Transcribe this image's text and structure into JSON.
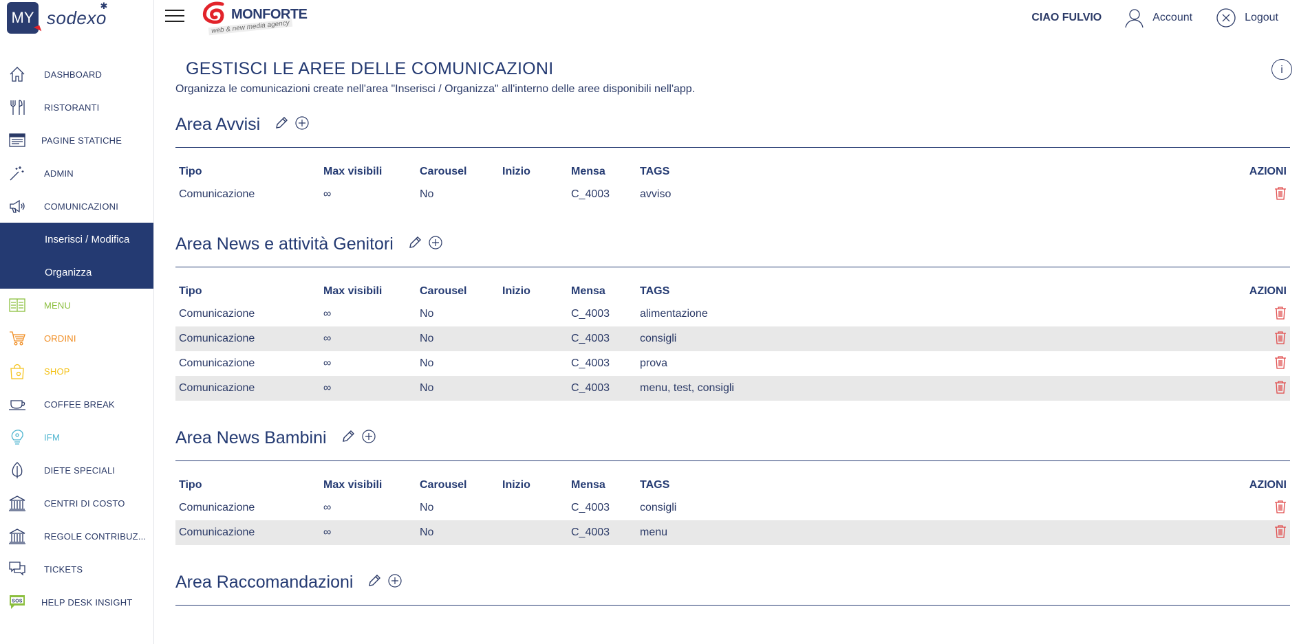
{
  "brand": {
    "my_label": "MY",
    "sodexo": "sodexo",
    "partner_name": "MONFORTE",
    "partner_tagline": "web & new media agency"
  },
  "header": {
    "greeting": "CIAO FULVIO",
    "account_label": "Account",
    "logout_label": "Logout"
  },
  "sidebar": {
    "items": [
      {
        "label": "DASHBOARD",
        "icon": "home-icon"
      },
      {
        "label": "RISTORANTI",
        "icon": "fork-knife-icon"
      },
      {
        "label": "PAGINE STATICHE",
        "icon": "page-icon"
      },
      {
        "label": "ADMIN",
        "icon": "wand-icon"
      },
      {
        "label": "COMUNICAZIONI",
        "icon": "megaphone-icon"
      }
    ],
    "sub_items": [
      {
        "label": "Inserisci / Modifica"
      },
      {
        "label": "Organizza"
      }
    ],
    "items_after": [
      {
        "label": "MENU",
        "icon": "menu-book-icon",
        "color": "#8cbf3f"
      },
      {
        "label": "ORDINI",
        "icon": "cart-icon",
        "color": "#f08d23"
      },
      {
        "label": "SHOP",
        "icon": "bag-icon",
        "color": "#f4c21a"
      },
      {
        "label": "COFFEE BREAK",
        "icon": "cup-icon"
      },
      {
        "label": "IFM",
        "icon": "bulb-icon",
        "color": "#4cb4cf"
      },
      {
        "label": "DIETE SPECIALI",
        "icon": "leaf-icon"
      },
      {
        "label": "CENTRI DI COSTO",
        "icon": "bank-icon"
      },
      {
        "label": "REGOLE CONTRIBUZ...",
        "icon": "bank-icon"
      },
      {
        "label": "TICKETS",
        "icon": "chat-icon"
      },
      {
        "label": "HELP DESK INSIGHT",
        "icon": "sos-icon"
      }
    ]
  },
  "page": {
    "title": "GESTISCI LE AREE DELLE COMUNICAZIONI",
    "subtitle": "Organizza le comunicazioni create nell'area \"Inserisci / Organizza\" all'interno delle aree disponibili nell'app.",
    "info_label": "i"
  },
  "columns": {
    "tipo": "Tipo",
    "max": "Max visibili",
    "carousel": "Carousel",
    "inizio": "Inizio",
    "mensa": "Mensa",
    "tags": "TAGS",
    "azioni": "AZIONI"
  },
  "areas": [
    {
      "title": "Area Avvisi",
      "rows": [
        {
          "tipo": "Comunicazione",
          "max": "∞",
          "carousel": "No",
          "inizio": "",
          "mensa": "C_4003",
          "tags": "avviso"
        }
      ]
    },
    {
      "title": "Area News e attività Genitori",
      "rows": [
        {
          "tipo": "Comunicazione",
          "max": "∞",
          "carousel": "No",
          "inizio": "",
          "mensa": "C_4003",
          "tags": "alimentazione"
        },
        {
          "tipo": "Comunicazione",
          "max": "∞",
          "carousel": "No",
          "inizio": "",
          "mensa": "C_4003",
          "tags": "consigli"
        },
        {
          "tipo": "Comunicazione",
          "max": "∞",
          "carousel": "No",
          "inizio": "",
          "mensa": "C_4003",
          "tags": "prova"
        },
        {
          "tipo": "Comunicazione",
          "max": "∞",
          "carousel": "No",
          "inizio": "",
          "mensa": "C_4003",
          "tags": "menu, test, consigli"
        }
      ]
    },
    {
      "title": "Area News Bambini",
      "rows": [
        {
          "tipo": "Comunicazione",
          "max": "∞",
          "carousel": "No",
          "inizio": "",
          "mensa": "C_4003",
          "tags": "consigli"
        },
        {
          "tipo": "Comunicazione",
          "max": "∞",
          "carousel": "No",
          "inizio": "",
          "mensa": "C_4003",
          "tags": "menu"
        }
      ]
    },
    {
      "title": "Area Raccomandazioni",
      "rows": []
    }
  ],
  "colors": {
    "navy": "#243a72",
    "text": "#2b3a67",
    "delete_red": "#e04b4b",
    "row_alt": "#e8e8e8"
  }
}
